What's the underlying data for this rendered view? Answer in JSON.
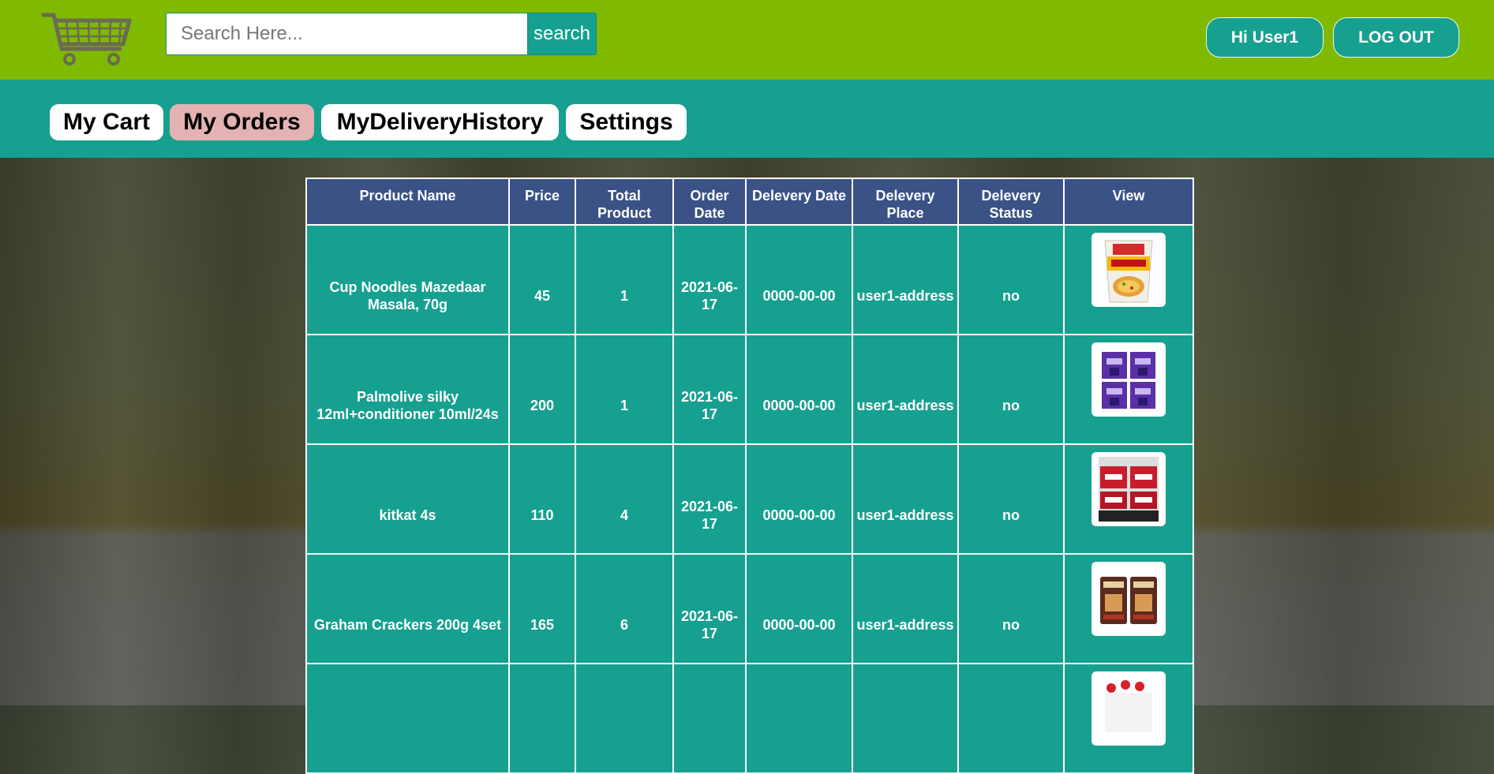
{
  "header": {
    "logo_icon": "shopping-cart-icon",
    "search": {
      "placeholder": "Search Here...",
      "value": "",
      "button_label": "search"
    },
    "greeting_label": "Hi User1",
    "logout_label": "LOG OUT"
  },
  "nav": {
    "tabs": [
      {
        "label": "My Cart",
        "active": false
      },
      {
        "label": "My Orders",
        "active": true
      },
      {
        "label": "MyDeliveryHistory",
        "active": false
      },
      {
        "label": "Settings",
        "active": false
      }
    ]
  },
  "orders": {
    "columns": [
      "Product Name",
      "Price",
      "Total Product",
      "Order Date",
      "Delevery Date",
      "Delevery Place",
      "Delevery Status",
      "View"
    ],
    "rows": [
      {
        "product": "Cup Noodles Mazedaar Masala, 70g",
        "price": "45",
        "total": "1",
        "order_date": "2021-06-17",
        "delivery_date": "0000-00-00",
        "place": "user1-address",
        "status": "no",
        "image": "cup-noodles-product-image"
      },
      {
        "product": "Palmolive silky 12ml+conditioner 10ml/24s",
        "price": "200",
        "total": "1",
        "order_date": "2021-06-17",
        "delivery_date": "0000-00-00",
        "place": "user1-address",
        "status": "no",
        "image": "palmolive-product-image"
      },
      {
        "product": "kitkat 4s",
        "price": "110",
        "total": "4",
        "order_date": "2021-06-17",
        "delivery_date": "0000-00-00",
        "place": "user1-address",
        "status": "no",
        "image": "kitkat-product-image"
      },
      {
        "product": "Graham Crackers 200g 4set",
        "price": "165",
        "total": "6",
        "order_date": "2021-06-17",
        "delivery_date": "0000-00-00",
        "place": "user1-address",
        "status": "no",
        "image": "graham-crackers-product-image"
      },
      {
        "product": "",
        "price": "",
        "total": "",
        "order_date": "",
        "delivery_date": "",
        "place": "",
        "status": "",
        "image": "product-image"
      }
    ]
  },
  "colors": {
    "header_green": "#7fba00",
    "teal": "#16a08f",
    "table_header_blue": "#3a5286",
    "active_tab_pink": "#e4b2b2"
  }
}
